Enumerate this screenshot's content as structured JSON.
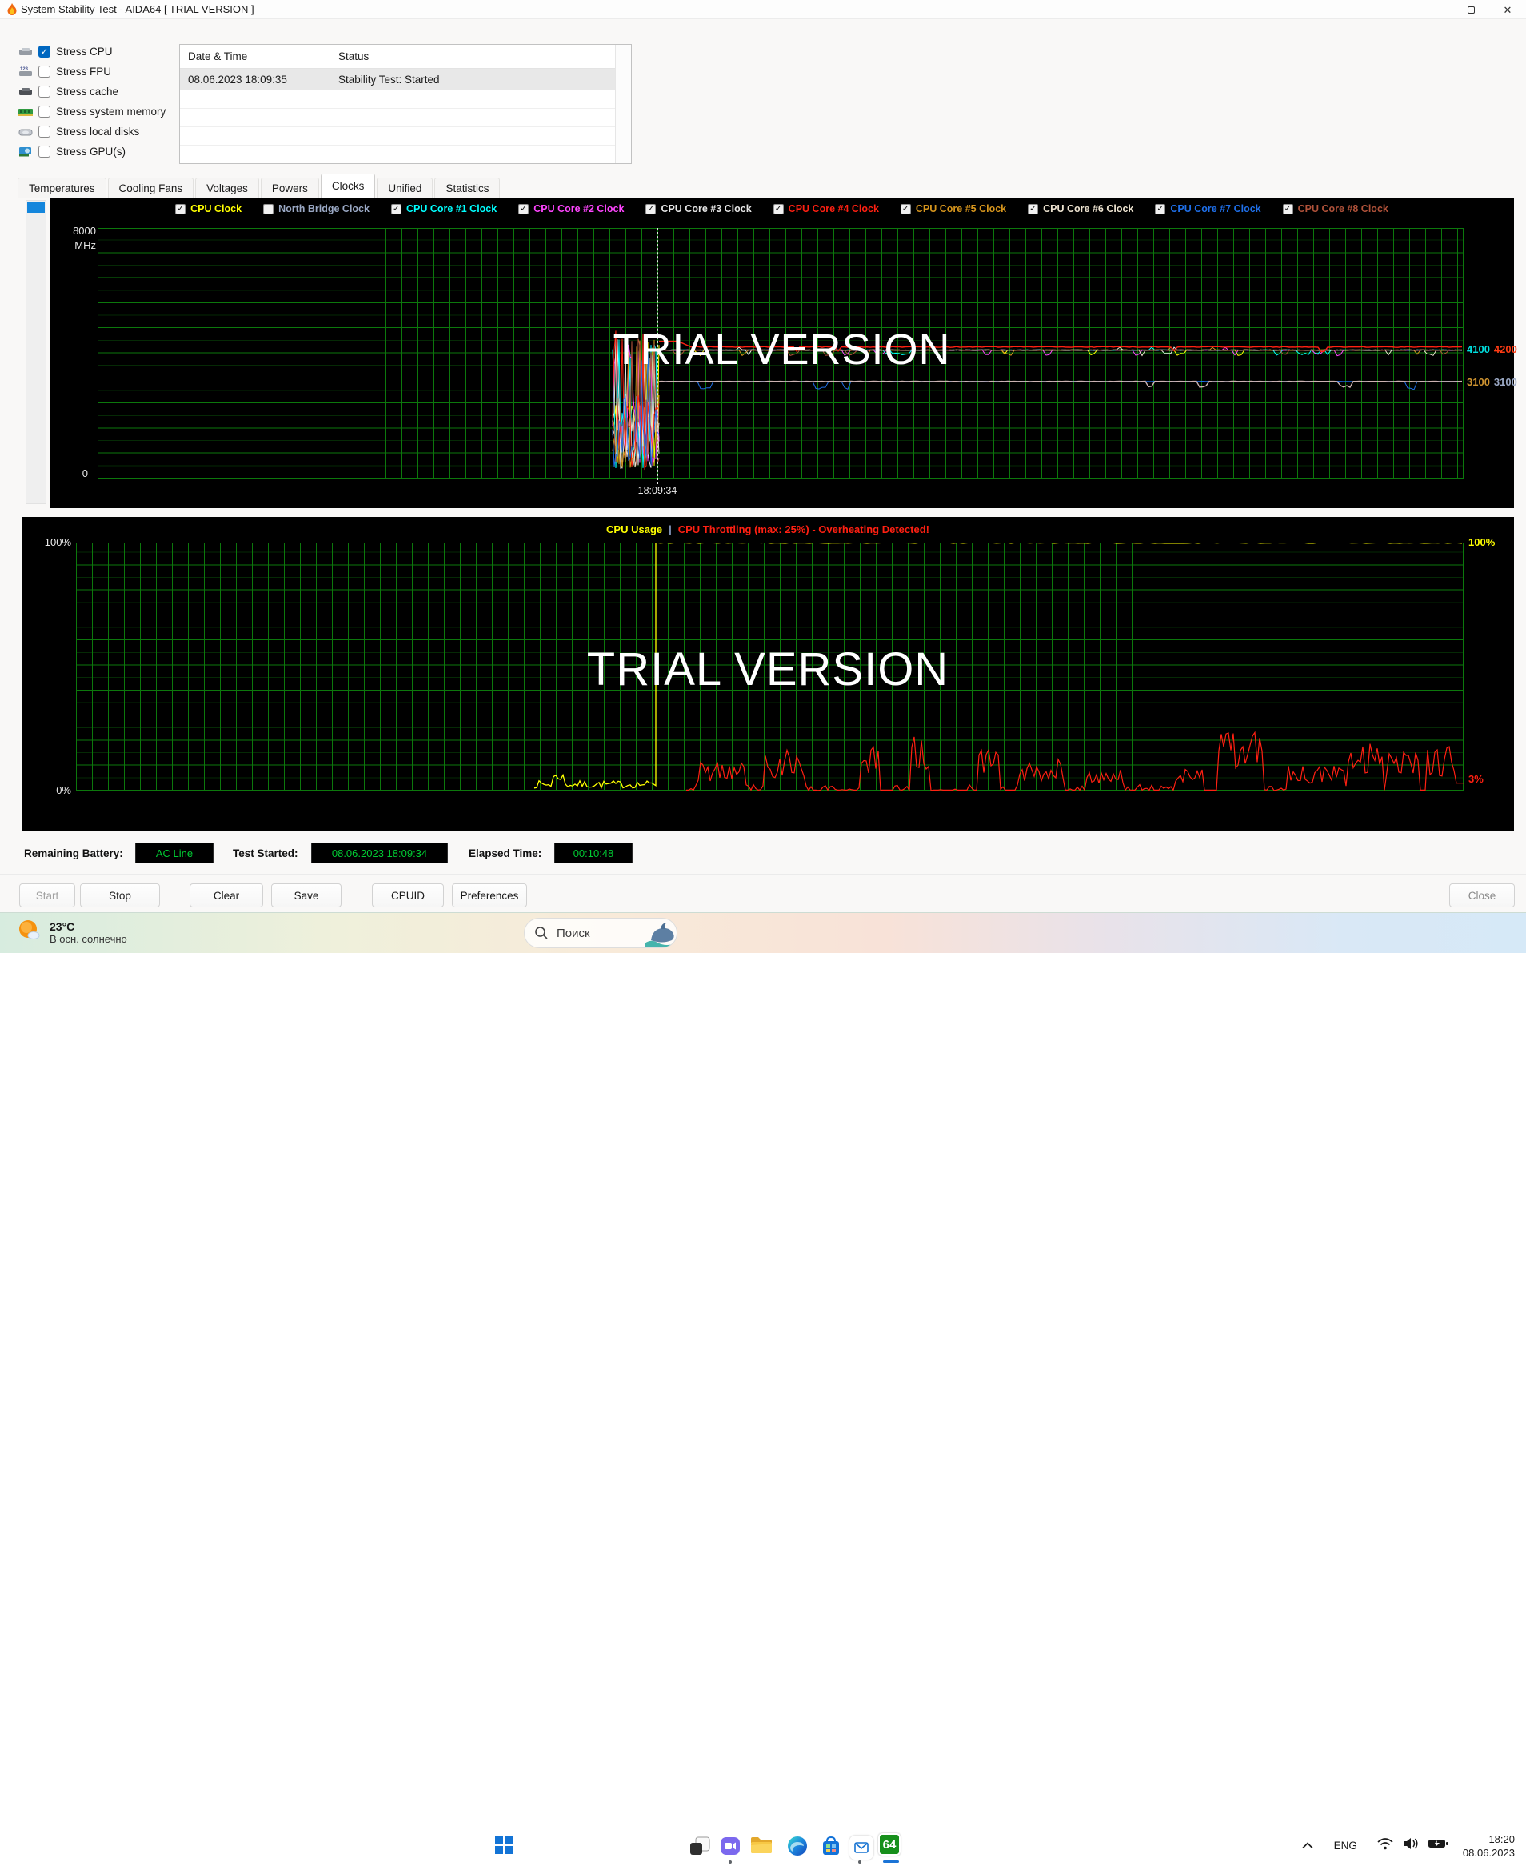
{
  "window": {
    "title": "System Stability Test - AIDA64  [ TRIAL VERSION ]",
    "controls": {
      "minimize": "–",
      "maximize": "□",
      "close": "✕"
    }
  },
  "stress_options": [
    {
      "label": "Stress CPU",
      "checked": true,
      "icon": "cpu"
    },
    {
      "label": "Stress FPU",
      "checked": false,
      "icon": "fpu"
    },
    {
      "label": "Stress cache",
      "checked": false,
      "icon": "cache"
    },
    {
      "label": "Stress system memory",
      "checked": false,
      "icon": "memory"
    },
    {
      "label": "Stress local disks",
      "checked": false,
      "icon": "disk"
    },
    {
      "label": "Stress GPU(s)",
      "checked": false,
      "icon": "gpu"
    }
  ],
  "log_table": {
    "columns": [
      "Date & Time",
      "Status"
    ],
    "rows": [
      [
        "08.06.2023 18:09:35",
        "Stability Test: Started"
      ]
    ],
    "empty_row_count": 4
  },
  "tabs": {
    "items": [
      "Temperatures",
      "Cooling Fans",
      "Voltages",
      "Powers",
      "Clocks",
      "Unified",
      "Statistics"
    ],
    "active": "Clocks"
  },
  "clock_chart": {
    "legend": [
      {
        "label": "CPU Clock",
        "color": "#ffff00",
        "checked": true
      },
      {
        "label": "North Bridge Clock",
        "color": "#9aa8c4",
        "checked": false
      },
      {
        "label": "CPU Core #1 Clock",
        "color": "#00ffff",
        "checked": true
      },
      {
        "label": "CPU Core #2 Clock",
        "color": "#ff45ff",
        "checked": true
      },
      {
        "label": "CPU Core #3 Clock",
        "color": "#e6e6e6",
        "checked": true
      },
      {
        "label": "CPU Core #4 Clock",
        "color": "#ff2012",
        "checked": true
      },
      {
        "label": "CPU Core #5 Clock",
        "color": "#d6951d",
        "checked": true
      },
      {
        "label": "CPU Core #6 Clock",
        "color": "#ece2cf",
        "checked": true
      },
      {
        "label": "CPU Core #7 Clock",
        "color": "#1f6fe8",
        "checked": true
      },
      {
        "label": "CPU Core #8 Clock",
        "color": "#b0523a",
        "checked": true
      }
    ],
    "y_max": "8000",
    "y_unit": "MHz",
    "y_min": "0",
    "marker_time": "18:09:34",
    "right_values_rows": [
      [
        {
          "text": "4100",
          "color": "#00e0e0"
        },
        {
          "text": "4200",
          "color": "#ff3c14"
        }
      ],
      [
        {
          "text": "3100",
          "color": "#cf9430"
        },
        {
          "text": "3100",
          "color": "#9aa8c4"
        }
      ]
    ],
    "levels": {
      "red": 4200,
      "cluster": 4100,
      "gray": 3100,
      "axis_max": 8000
    },
    "colors": {
      "gray_line": "#ccb2b2"
    },
    "watermark": "TRIAL VERSION"
  },
  "usage_chart": {
    "title_usage": "CPU Usage",
    "title_sep": "|",
    "title_throttle": "CPU Throttling (max: 25%) - Overheating Detected!",
    "title_usage_color": "#ffff00",
    "title_throttle_color": "#ff2012",
    "y_top": "100%",
    "y_bottom": "0%",
    "right_top": "100%",
    "right_top_color": "#ffff00",
    "right_bottom": "3%",
    "right_bottom_color": "#ff2012",
    "usage_color": "#ffff00",
    "throttle_color": "#ff2012",
    "watermark": "TRIAL VERSION"
  },
  "status_bar": {
    "battery_label": "Remaining Battery:",
    "battery_value": "AC Line",
    "started_label": "Test Started:",
    "started_value": "08.06.2023 18:09:34",
    "elapsed_label": "Elapsed Time:",
    "elapsed_value": "00:10:48"
  },
  "buttons": {
    "start": "Start",
    "stop": "Stop",
    "clear": "Clear",
    "save": "Save",
    "cpuid": "CPUID",
    "preferences": "Preferences",
    "close": "Close"
  },
  "taskbar": {
    "weather": {
      "temp": "23°C",
      "desc": "В осн. солнечно"
    },
    "search_placeholder": "Поиск",
    "aida_label": "64",
    "tray": {
      "lang": "ENG",
      "time": "18:20",
      "date": "08.06.2023"
    }
  }
}
